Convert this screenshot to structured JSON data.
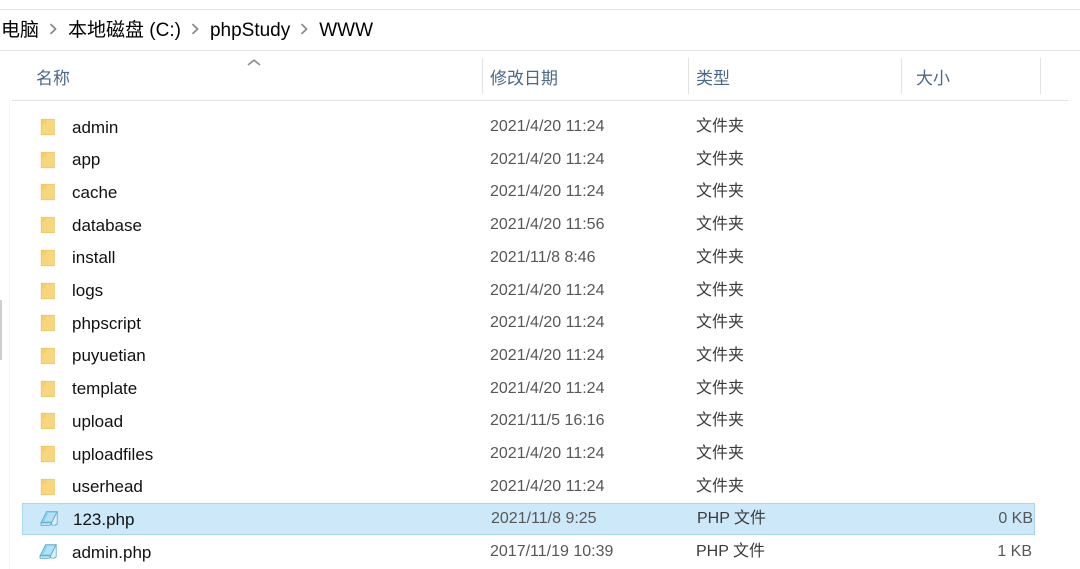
{
  "window": {
    "app": "file-explorer"
  },
  "breadcrumb": {
    "name": "address-breadcrumb",
    "items": [
      {
        "label": "电脑"
      },
      {
        "label": "本地磁盘 (C:)"
      },
      {
        "label": "phpStudy"
      },
      {
        "label": "WWW"
      }
    ],
    "separator_icon": "chevron-right-icon"
  },
  "columns": {
    "name": "名称",
    "date": "修改日期",
    "type": "类型",
    "size": "大小",
    "sort_column": "名称",
    "sort_direction": "ascending",
    "sort_icon": "chevron-up-icon"
  },
  "colors": {
    "selection_fill": "#cce8f9",
    "selection_border": "#a9d5ef",
    "header_text": "#4a6889",
    "folder_icon": "#f8d77c",
    "php_icon": "#8fd2ef"
  },
  "files": [
    {
      "name": "admin",
      "date": "2021/4/20 11:24",
      "type": "文件夹",
      "size": "",
      "icon": "folder-icon",
      "selected": false
    },
    {
      "name": "app",
      "date": "2021/4/20 11:24",
      "type": "文件夹",
      "size": "",
      "icon": "folder-icon",
      "selected": false
    },
    {
      "name": "cache",
      "date": "2021/4/20 11:24",
      "type": "文件夹",
      "size": "",
      "icon": "folder-icon",
      "selected": false
    },
    {
      "name": "database",
      "date": "2021/4/20 11:56",
      "type": "文件夹",
      "size": "",
      "icon": "folder-icon",
      "selected": false
    },
    {
      "name": "install",
      "date": "2021/11/8 8:46",
      "type": "文件夹",
      "size": "",
      "icon": "folder-icon",
      "selected": false
    },
    {
      "name": "logs",
      "date": "2021/4/20 11:24",
      "type": "文件夹",
      "size": "",
      "icon": "folder-icon",
      "selected": false
    },
    {
      "name": "phpscript",
      "date": "2021/4/20 11:24",
      "type": "文件夹",
      "size": "",
      "icon": "folder-icon",
      "selected": false
    },
    {
      "name": "puyuetian",
      "date": "2021/4/20 11:24",
      "type": "文件夹",
      "size": "",
      "icon": "folder-icon",
      "selected": false
    },
    {
      "name": "template",
      "date": "2021/4/20 11:24",
      "type": "文件夹",
      "size": "",
      "icon": "folder-icon",
      "selected": false
    },
    {
      "name": "upload",
      "date": "2021/11/5 16:16",
      "type": "文件夹",
      "size": "",
      "icon": "folder-icon",
      "selected": false
    },
    {
      "name": "uploadfiles",
      "date": "2021/4/20 11:24",
      "type": "文件夹",
      "size": "",
      "icon": "folder-icon",
      "selected": false
    },
    {
      "name": "userhead",
      "date": "2021/4/20 11:24",
      "type": "文件夹",
      "size": "",
      "icon": "folder-icon",
      "selected": false
    },
    {
      "name": "123.php",
      "date": "2021/11/8 9:25",
      "type": "PHP 文件",
      "size": "0 KB",
      "icon": "php-file-icon",
      "selected": true
    },
    {
      "name": "admin.php",
      "date": "2017/11/19 10:39",
      "type": "PHP 文件",
      "size": "1 KB",
      "icon": "php-file-icon",
      "selected": false
    }
  ]
}
